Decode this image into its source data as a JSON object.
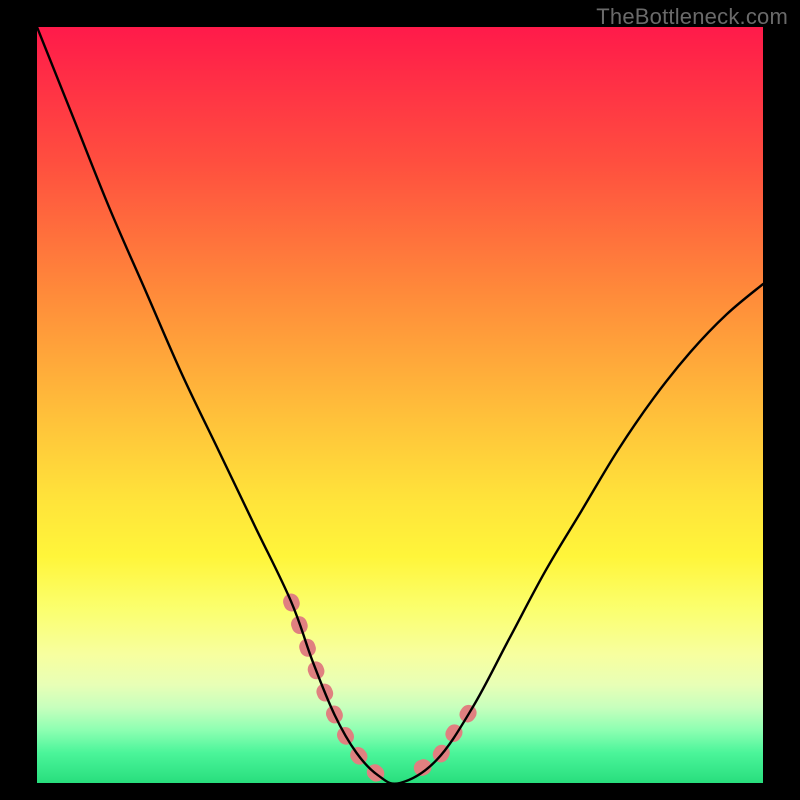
{
  "watermark": "TheBottleneck.com",
  "chart_data": {
    "type": "line",
    "title": "",
    "xlabel": "",
    "ylabel": "",
    "xlim": [
      0,
      100
    ],
    "ylim": [
      0,
      100
    ],
    "series": [
      {
        "name": "curve",
        "x": [
          0,
          5,
          10,
          15,
          20,
          25,
          30,
          35,
          38,
          41,
          44,
          47,
          50,
          55,
          60,
          65,
          70,
          75,
          80,
          85,
          90,
          95,
          100
        ],
        "values": [
          100,
          88,
          76,
          65,
          54,
          44,
          34,
          24,
          16,
          9,
          4,
          1,
          0,
          3,
          10,
          19,
          28,
          36,
          44,
          51,
          57,
          62,
          66
        ]
      }
    ],
    "highlight_segments": [
      {
        "name": "left-descent",
        "x": [
          35,
          38,
          41,
          44,
          47
        ],
        "values": [
          24,
          16,
          9,
          4,
          1
        ]
      },
      {
        "name": "right-ascent",
        "x": [
          53,
          55,
          57,
          60
        ],
        "values": [
          2,
          3,
          6,
          10
        ]
      }
    ],
    "colors": {
      "curve": "#000000",
      "highlight": "#e08080",
      "background_top": "#ff1a4a",
      "background_bottom": "#28de7d",
      "frame": "#000000"
    }
  }
}
